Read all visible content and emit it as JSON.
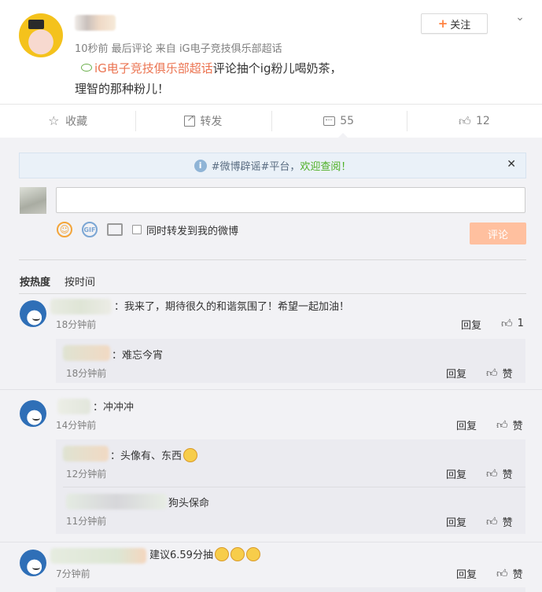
{
  "post": {
    "meta": "10秒前 最后评论 来自 iG电子竞技俱乐部超话",
    "topic_link": "iG电子竞技俱乐部超话",
    "text_line1": "评论抽个ig粉儿喝奶茶，",
    "text_line2": "理智的那种粉儿！",
    "follow_label": "关注"
  },
  "actions": {
    "favorite": "收藏",
    "forward": "转发",
    "comment_count": "55",
    "like_count": "12"
  },
  "notice": {
    "text": "#微博辟谣#平台，",
    "highlight": "欢迎查阅！"
  },
  "compose": {
    "sync_label": "同时转发到我的微博",
    "submit": "评论"
  },
  "sort": {
    "hot": "按热度",
    "time": "按时间"
  },
  "comments": [
    {
      "text": "：我来了，期待很久的和谐氛围了！希望一起加油！",
      "time": "18分钟前",
      "reply": "回复",
      "likes": "1",
      "replies": [
        {
          "text": "：难忘今宵",
          "time": "18分钟前",
          "reply": "回复",
          "likes": "赞"
        }
      ]
    },
    {
      "text": "：冲冲冲",
      "time": "14分钟前",
      "reply": "回复",
      "likes": "赞",
      "replies": [
        {
          "text": "：头像有、东西",
          "time": "12分钟前",
          "reply": "回复",
          "likes": "赞"
        },
        {
          "text": "狗头保命",
          "time": "11分钟前",
          "reply": "回复",
          "likes": "赞"
        }
      ]
    },
    {
      "text": "建议6.59分抽",
      "time": "7分钟前",
      "reply": "回复",
      "likes": "赞"
    }
  ]
}
